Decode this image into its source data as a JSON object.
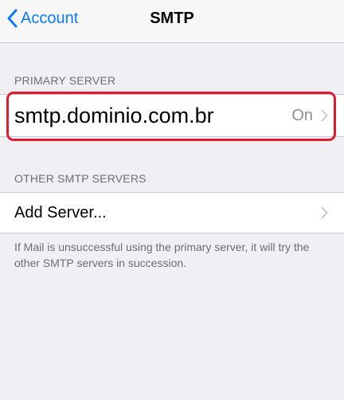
{
  "navbar": {
    "back_label": "Account",
    "title": "SMTP"
  },
  "primary_section": {
    "header": "PRIMARY SERVER",
    "server": {
      "label": "smtp.dominio.com.br",
      "detail": "On"
    }
  },
  "other_section": {
    "header": "OTHER SMTP SERVERS",
    "add_server_label": "Add Server..."
  },
  "footer": "If Mail is unsuccessful using the primary server, it will try the other SMTP servers in succession.",
  "colors": {
    "accent": "#0a7aff",
    "highlight": "#e01b2e",
    "background": "#efeff4"
  },
  "icons": {
    "back": "chevron-left-icon",
    "disclosure": "chevron-right-icon"
  }
}
